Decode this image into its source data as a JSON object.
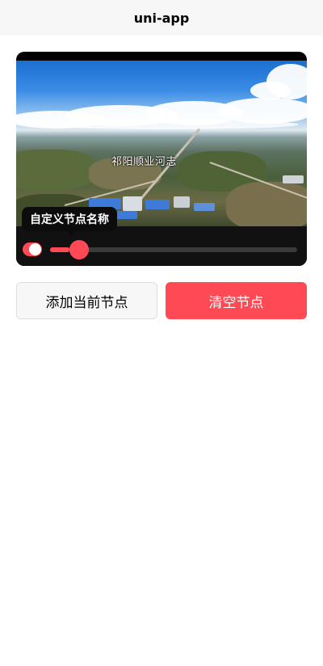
{
  "navbar": {
    "title": "uni-app"
  },
  "video": {
    "subtitle": "祁阳顺业河志",
    "node_tooltip": "自定义节点名称",
    "progress_fraction": 0.08,
    "toggle_on": true
  },
  "actions": {
    "add_label": "添加当前节点",
    "clear_label": "清空节点"
  },
  "colors": {
    "accent": "#ff4a55",
    "navbar_bg": "#f7f7f7",
    "player_bg": "#000000"
  }
}
